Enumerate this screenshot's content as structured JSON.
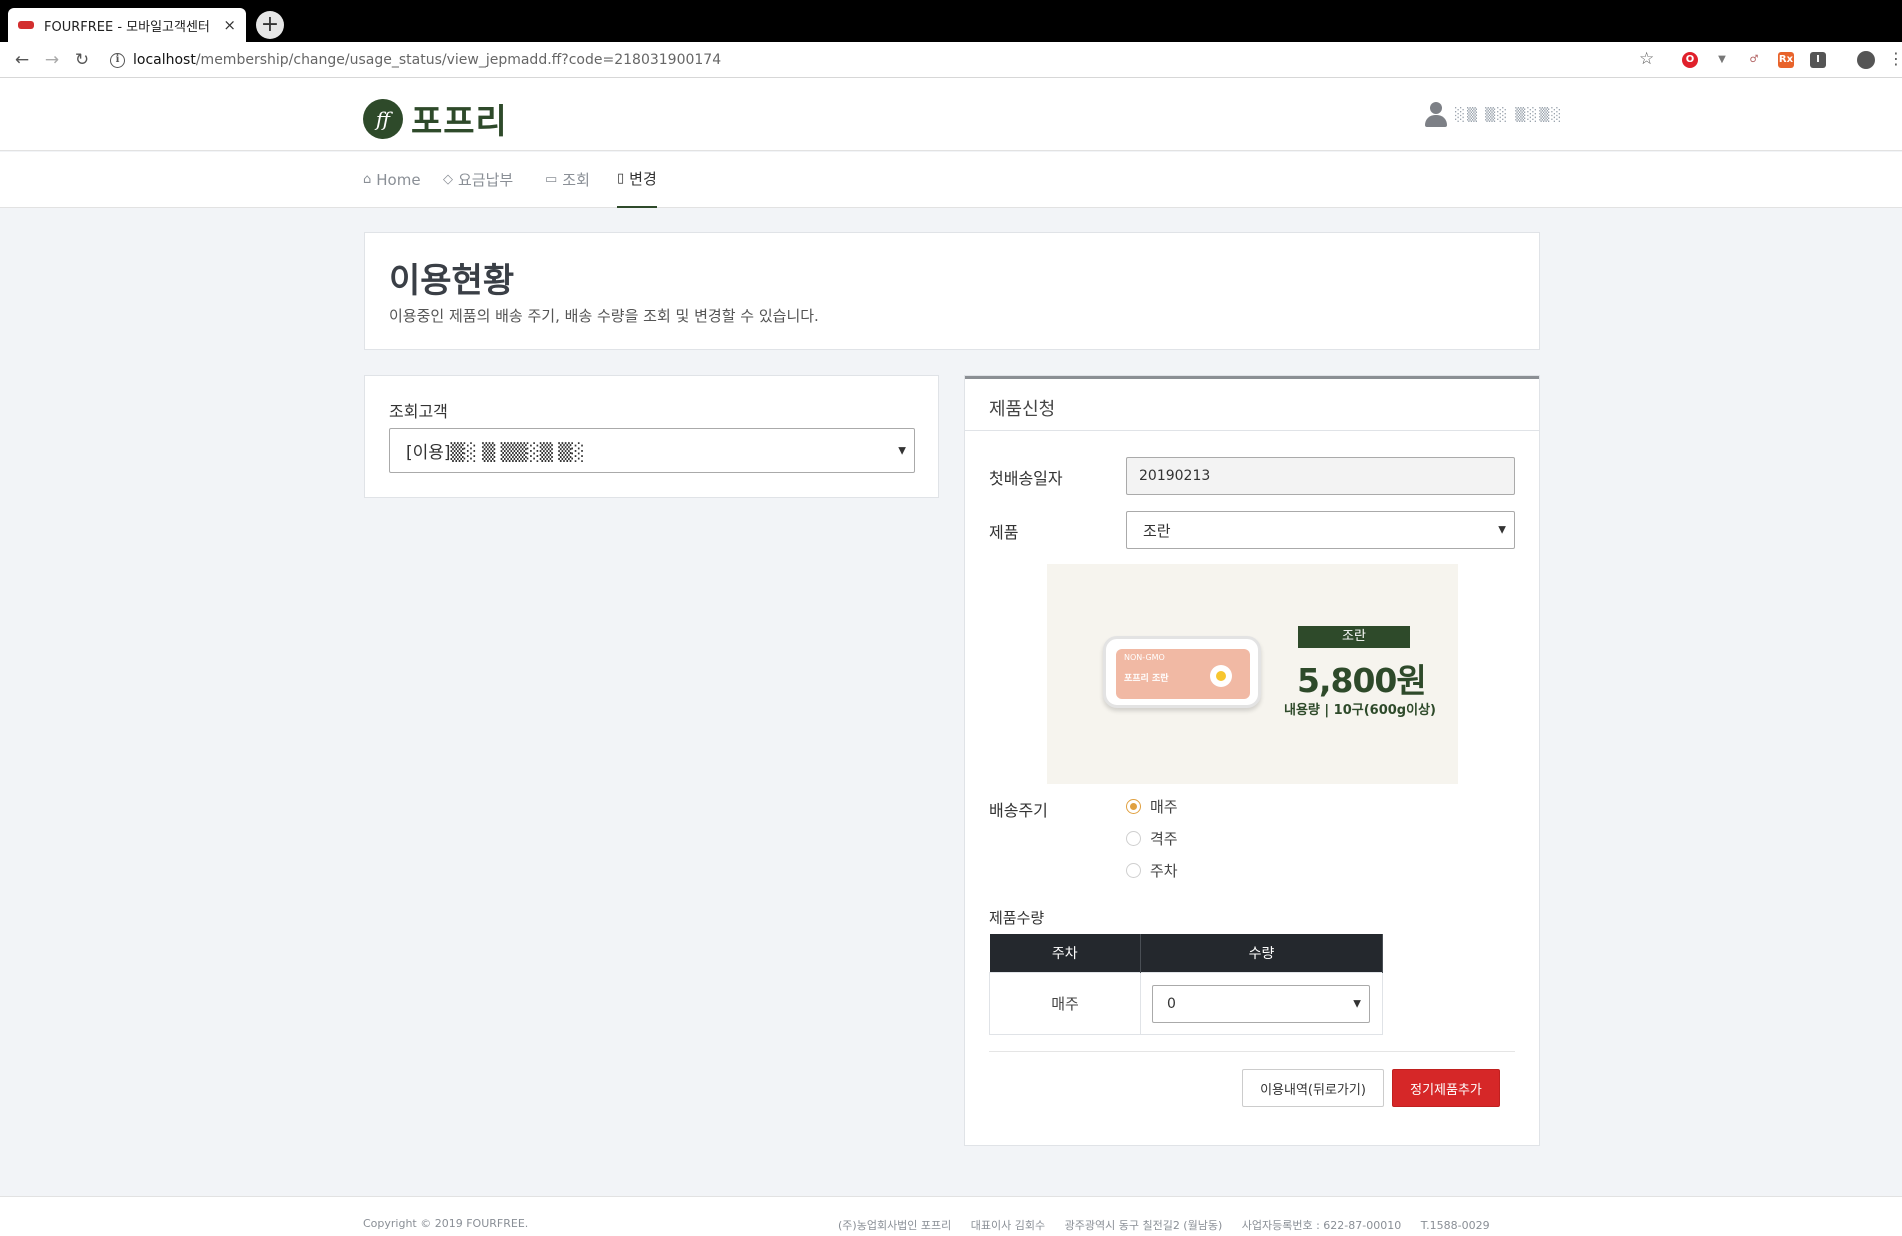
{
  "browser": {
    "tab_title": "FOURFREE - 모바일고객센터",
    "tab_close": "×",
    "new_tab": "+",
    "url_host": "localhost",
    "url_path": "/membership/change/usage_status/view_jepmadd.ff?code=218031900174"
  },
  "header": {
    "logo_mark": "ff",
    "logo_text": "포프리",
    "user_name": "░▒ ▒░ ▒░▒░"
  },
  "nav": {
    "items": [
      {
        "icon": "⌂",
        "label": "Home"
      },
      {
        "icon": "◇",
        "label": "요금납부"
      },
      {
        "icon": "▭",
        "label": "조회"
      },
      {
        "icon": "▯",
        "label": "변경"
      }
    ]
  },
  "intro": {
    "title": "이용현황",
    "description": "이용중인 제품의 배송 주기, 배송 수량을 조회 및 변경할 수 있습니다."
  },
  "customer": {
    "label": "조회고객",
    "selected": "[이용]▒░ ▒ ▒▒░▒ ▒░"
  },
  "order": {
    "panel_title": "제품신청",
    "first_delivery_label": "첫배송일자",
    "first_delivery_value": "20190213",
    "product_label": "제품",
    "product_value": "조란",
    "image": {
      "box_line1": "NON-GMO",
      "box_line2": "포프리 조란",
      "tag": "조란",
      "price": "5,800원",
      "volume": "내용량 | 10구(600g이상)"
    },
    "cycle_label": "배송주기",
    "cycle_options": [
      {
        "label": "매주",
        "checked": true
      },
      {
        "label": "격주",
        "checked": false
      },
      {
        "label": "주차",
        "checked": false
      }
    ],
    "qty_label": "제품수량",
    "qty_table": {
      "headers": [
        "주차",
        "수량"
      ],
      "rows": [
        {
          "week": "매주",
          "qty": "0"
        }
      ]
    },
    "buttons": {
      "back": "이용내역(뒤로가기)",
      "add": "정기제품추가"
    }
  },
  "footer": {
    "copyright": "Copyright © 2019 FOURFREE.",
    "company": "(주)농업회사법인 포프리",
    "ceo": "대표이사 김회수",
    "address": "광주광역시 동구 칠전길2 (월남동)",
    "biz_no": "사업자등록번호 : 622-87-00010",
    "tel": "T.1588-0029"
  },
  "colors": {
    "brand_green": "#2e4a2a",
    "primary_red": "#d62728",
    "radio_accent": "#e0a040"
  }
}
